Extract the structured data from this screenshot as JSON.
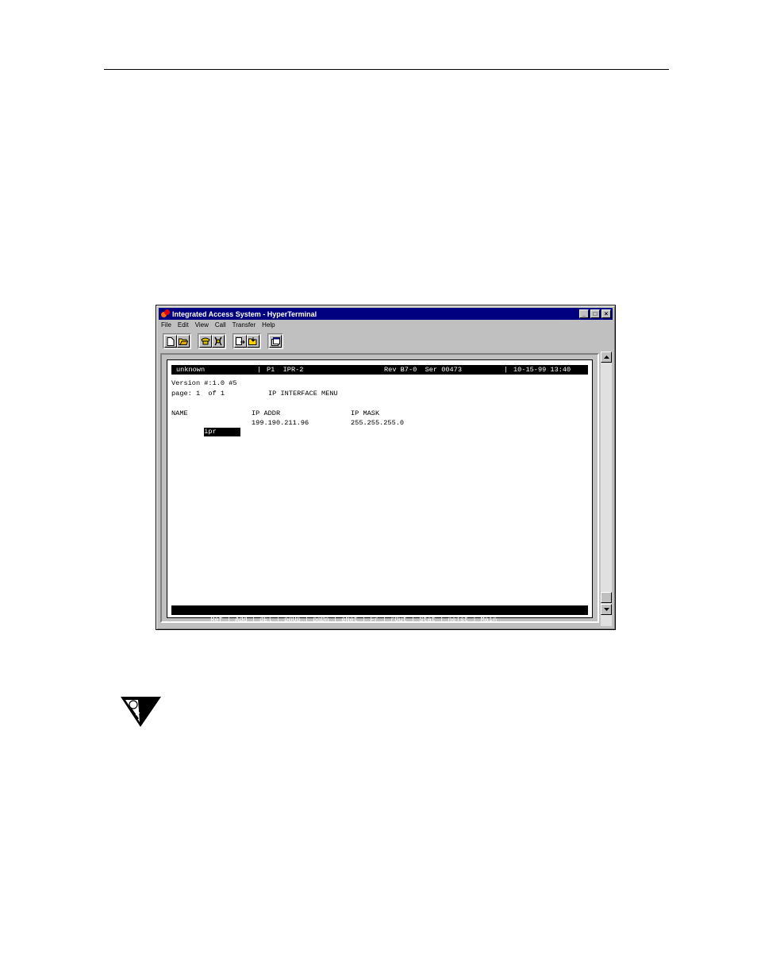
{
  "window": {
    "title": "Integrated Access System - HyperTerminal",
    "controls": {
      "minimize": "_",
      "maximize": "□",
      "close": "×"
    }
  },
  "menubar": [
    "File",
    "Edit",
    "View",
    "Call",
    "Transfer",
    "Help"
  ],
  "toolbar": {
    "buttons": [
      "new-icon",
      "open-icon",
      "connect-icon",
      "disconnect-icon",
      "send-icon",
      "receive-icon",
      "properties-icon"
    ]
  },
  "terminal": {
    "status": {
      "node": "unknown",
      "slot": "P1  IPR-2",
      "rev": "Rev B7-0  Ser 00473",
      "datetime": "10-15-99 13:40"
    },
    "version": "Version #:1.0 #5",
    "page": "page: 1  of 1",
    "menu_title": "IP INTERFACE MENU",
    "columns": {
      "name": "NAME",
      "ip_addr": "IP ADDR",
      "ip_mask": "IP MASK"
    },
    "rows": [
      {
        "name": "ipr",
        "ip_addr": "199.190.211.96",
        "ip_mask": "255.255.255.0"
      }
    ],
    "commands": "Ref | Add | dEl | pgUp | pgDn | eNet | Fr | rOut | Stat | neTst | Main"
  },
  "icons": {
    "note": "note-icon"
  }
}
